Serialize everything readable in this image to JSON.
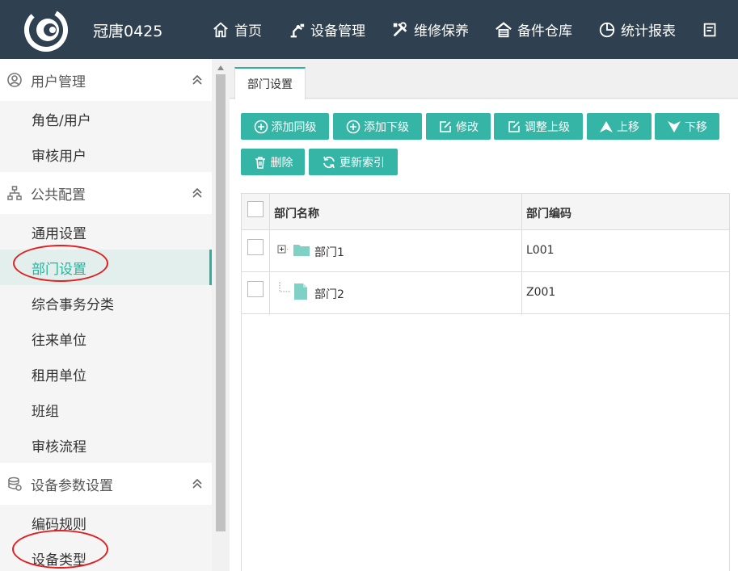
{
  "header": {
    "brand": "冠唐0425",
    "nav": [
      {
        "label": "首页",
        "icon": "home-icon"
      },
      {
        "label": "设备管理",
        "icon": "robot-arm-icon"
      },
      {
        "label": "维修保养",
        "icon": "tools-icon"
      },
      {
        "label": "备件仓库",
        "icon": "warehouse-icon"
      },
      {
        "label": "统计报表",
        "icon": "pie-chart-icon"
      }
    ]
  },
  "sidebar": {
    "groups": [
      {
        "title": "用户管理",
        "icon": "user-circle-icon",
        "items": [
          "角色/用户",
          "审核用户"
        ]
      },
      {
        "title": "公共配置",
        "icon": "org-chart-icon",
        "items": [
          "通用设置",
          "部门设置",
          "综合事务分类",
          "往来单位",
          "租用单位",
          "班组",
          "审核流程"
        ]
      },
      {
        "title": "设备参数设置",
        "icon": "database-gear-icon",
        "items": [
          "编码规则",
          "设备类型"
        ]
      }
    ],
    "active_item": "部门设置"
  },
  "tab": {
    "label": "部门设置"
  },
  "toolbar": {
    "add_sibling": "添加同级",
    "add_child": "添加下级",
    "edit": "修改",
    "reparent": "调整上级",
    "move_up": "上移",
    "move_down": "下移",
    "delete": "删除",
    "reindex": "更新索引"
  },
  "table": {
    "columns": [
      "部门名称",
      "部门编码"
    ],
    "rows": [
      {
        "name": "部门1",
        "code": "L001",
        "type": "folder",
        "expandable": true
      },
      {
        "name": "部门2",
        "code": "Z001",
        "type": "file",
        "expandable": false
      }
    ]
  },
  "colors": {
    "header_bg": "#2f4050",
    "accent": "#2ab29f",
    "button": "#35b5a5",
    "annotation": "#e02020"
  }
}
